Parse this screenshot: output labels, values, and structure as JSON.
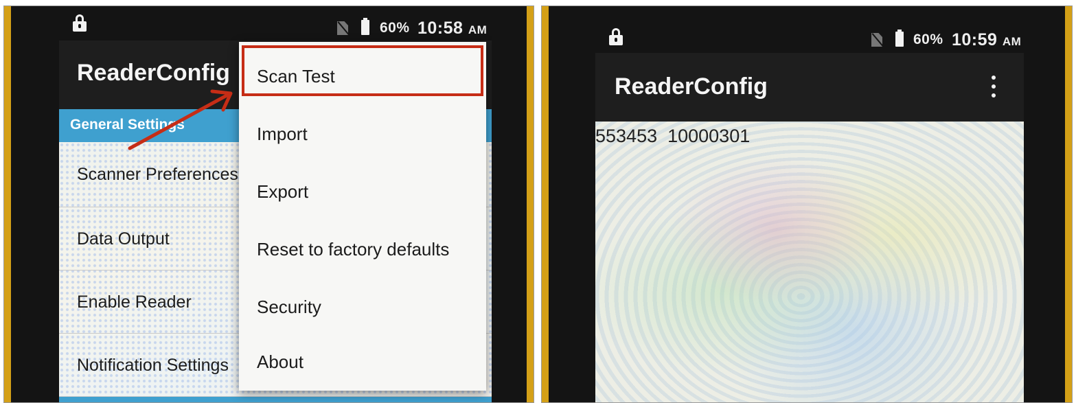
{
  "left_screen": {
    "status_bar": {
      "lock_icon": "lock-icon",
      "sim_icon": "no-sim-icon",
      "battery_icon": "battery-icon",
      "battery_percent": "60%",
      "time": "10:58",
      "ampm": "AM"
    },
    "app_bar": {
      "title": "ReaderConfig"
    },
    "settings": {
      "section_header": "General Settings",
      "items": [
        {
          "label": "Scanner Preferences"
        },
        {
          "label": "Data Output"
        },
        {
          "label": "Enable Reader"
        },
        {
          "label": "Notification Settings"
        }
      ]
    },
    "overflow_menu": {
      "items": [
        {
          "label": "Scan Test"
        },
        {
          "label": "Import"
        },
        {
          "label": "Export"
        },
        {
          "label": "Reset to factory defaults"
        },
        {
          "label": "Security"
        },
        {
          "label": "About"
        }
      ]
    },
    "annotation": {
      "color": "#c62d16"
    }
  },
  "right_screen": {
    "status_bar": {
      "lock_icon": "lock-icon",
      "sim_icon": "no-sim-icon",
      "battery_icon": "battery-icon",
      "battery_percent": "60%",
      "time": "10:59",
      "ampm": "AM"
    },
    "app_bar": {
      "title": "ReaderConfig",
      "overflow_icon": "more-vert-icon"
    },
    "scan_result": "553453  10000301"
  },
  "colors": {
    "section_header": "#3fa0cf",
    "app_bar": "#1e1e1e",
    "highlight": "#c62d16",
    "device_bezel": "#d4a017"
  }
}
